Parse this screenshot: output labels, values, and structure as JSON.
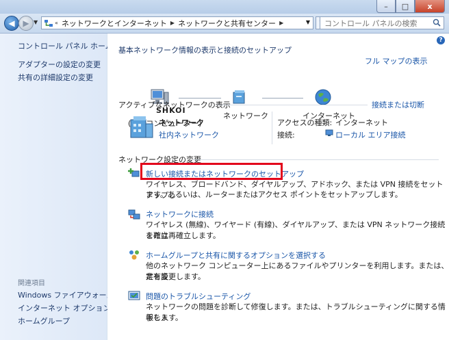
{
  "window": {
    "minimize_label": "–",
    "maximize_label": "□",
    "close_label": "x"
  },
  "navbar": {
    "back_label": "◀",
    "forward_label": "▶",
    "breadcrumb_prefix": "«",
    "breadcrumb": [
      "ネットワークとインターネット",
      "ネットワークと共有センター"
    ],
    "refresh_label": "↻",
    "search_placeholder": "コントロール パネルの検索"
  },
  "sidebar": {
    "home": "コントロール パネル ホーム",
    "links": [
      "アダプターの設定の変更",
      "共有の詳細設定の変更"
    ],
    "related_heading": "関連項目",
    "related": [
      "Windows ファイアウォール",
      "インターネット オプション",
      "ホームグループ"
    ]
  },
  "main": {
    "help_label": "?",
    "heading": "基本ネットワーク情報の表示と接続のセットアップ",
    "full_map": "フル マップの表示",
    "map": {
      "computer_name": "SHKOI",
      "computer_sub": "(このコンピューター)",
      "network": "ネットワーク",
      "internet": "インターネット"
    },
    "active_heading": "アクティブなネットワークの表示",
    "connect_disconnect": "接続または切断",
    "network_name": "ネットワーク",
    "network_type": "社内ネットワーク",
    "access_type_label": "アクセスの種類:",
    "access_type_value": "インターネット",
    "connection_label": "接続:",
    "connection_value": "ローカル エリア接続",
    "settings_heading": "ネットワーク設定の変更",
    "tasks": [
      {
        "title": "新しい接続またはネットワークのセットアップ",
        "desc": [
          "ワイヤレス、ブロードバンド、ダイヤルアップ、アドホック、または VPN 接続をセットアップし",
          "ます。あるいは、ルーターまたはアクセス ポイントをセットアップします。"
        ]
      },
      {
        "title": "ネットワークに接続",
        "desc": [
          "ワイヤレス (無線)、ワイヤード (有線)、ダイヤルアップ、または VPN ネットワーク接続を確立",
          "または再確立します。"
        ]
      },
      {
        "title": "ホームグループと共有に関するオプションを選択する",
        "desc": [
          "他のネットワーク コンピューター上にあるファイルやプリンターを利用します。または、共有設",
          "定を変更します。"
        ]
      },
      {
        "title": "問題のトラブルシューティング",
        "desc": [
          "ネットワークの問題を診断して修復します。または、トラブルシューティングに関する情報を入",
          "手します。"
        ]
      }
    ]
  },
  "colors": {
    "link": "#1a56a8",
    "sidebar_bg": "#eaf1fb",
    "highlight": "#e2001a"
  }
}
